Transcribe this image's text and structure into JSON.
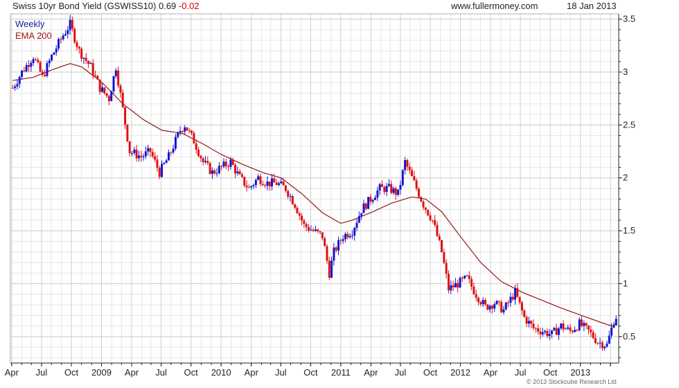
{
  "header": {
    "title": "Swiss 10yr Bond Yield (GSWISS10) 0.69",
    "change": "-0.02",
    "site": "www.fullermoney.com",
    "date": "18 Jan 2013"
  },
  "legend": {
    "weekly": "Weekly",
    "ema": "EMA 200"
  },
  "footer": {
    "copyright": "© 2013 Stockcube Research Ltd"
  },
  "colors": {
    "up_candle": "#1414d2",
    "down_candle": "#e01010",
    "ema_line": "#8b1a1a",
    "grid": "#d8d8d8",
    "axis": "#222222"
  },
  "chart_data": {
    "type": "candlestick",
    "xlabel": "",
    "ylabel": "",
    "ylim": [
      0.25,
      3.55
    ],
    "y_ticks": [
      "0.5",
      "1",
      "1.5",
      "2",
      "2.5",
      "3",
      "3.5"
    ],
    "x_ticks": [
      "Apr",
      "Jul",
      "Oct",
      "2009",
      "Apr",
      "Jul",
      "Oct",
      "2010",
      "Apr",
      "Jul",
      "Oct",
      "2011",
      "Apr",
      "Jul",
      "Oct",
      "2012",
      "Apr",
      "Jul",
      "Oct",
      "2013"
    ],
    "grid": true,
    "series": [
      {
        "name": "Weekly",
        "close_path": [
          [
            "2008-01-04",
            2.85
          ],
          [
            "2008-02-01",
            3.0
          ],
          [
            "2008-03-07",
            3.15
          ],
          [
            "2008-04-04",
            2.95
          ],
          [
            "2008-05-02",
            3.15
          ],
          [
            "2008-06-06",
            3.35
          ],
          [
            "2008-06-27",
            3.45
          ],
          [
            "2008-07-25",
            3.2
          ],
          [
            "2008-08-29",
            3.05
          ],
          [
            "2008-09-26",
            2.85
          ],
          [
            "2008-10-24",
            2.75
          ],
          [
            "2008-11-14",
            3.05
          ],
          [
            "2008-12-05",
            2.65
          ],
          [
            "2008-12-26",
            2.25
          ],
          [
            "2009-01-30",
            2.2
          ],
          [
            "2009-02-27",
            2.25
          ],
          [
            "2009-03-27",
            2.05
          ],
          [
            "2009-04-24",
            2.2
          ],
          [
            "2009-05-29",
            2.45
          ],
          [
            "2009-06-12",
            2.5
          ],
          [
            "2009-07-10",
            2.35
          ],
          [
            "2009-08-07",
            2.15
          ],
          [
            "2009-09-04",
            2.05
          ],
          [
            "2009-10-02",
            2.1
          ],
          [
            "2009-10-30",
            2.15
          ],
          [
            "2009-11-27",
            2.0
          ],
          [
            "2009-12-25",
            1.9
          ],
          [
            "2010-01-22",
            2.0
          ],
          [
            "2010-02-19",
            1.95
          ],
          [
            "2010-03-19",
            1.95
          ],
          [
            "2010-04-16",
            1.9
          ],
          [
            "2010-05-14",
            1.75
          ],
          [
            "2010-06-11",
            1.55
          ],
          [
            "2010-07-09",
            1.5
          ],
          [
            "2010-08-06",
            1.45
          ],
          [
            "2010-08-27",
            1.1
          ],
          [
            "2010-09-10",
            1.3
          ],
          [
            "2010-10-08",
            1.45
          ],
          [
            "2010-11-05",
            1.5
          ],
          [
            "2010-12-03",
            1.7
          ],
          [
            "2010-12-31",
            1.8
          ],
          [
            "2011-01-28",
            1.9
          ],
          [
            "2011-02-25",
            1.9
          ],
          [
            "2011-03-25",
            1.85
          ],
          [
            "2011-04-15",
            2.15
          ],
          [
            "2011-05-13",
            1.95
          ],
          [
            "2011-06-10",
            1.75
          ],
          [
            "2011-07-08",
            1.6
          ],
          [
            "2011-08-05",
            1.3
          ],
          [
            "2011-08-26",
            0.95
          ],
          [
            "2011-09-23",
            1.0
          ],
          [
            "2011-10-21",
            1.05
          ],
          [
            "2011-11-18",
            0.9
          ],
          [
            "2011-12-16",
            0.78
          ],
          [
            "2012-01-13",
            0.82
          ],
          [
            "2012-02-10",
            0.75
          ],
          [
            "2012-03-16",
            0.92
          ],
          [
            "2012-04-13",
            0.68
          ],
          [
            "2012-05-11",
            0.58
          ],
          [
            "2012-06-08",
            0.55
          ],
          [
            "2012-07-06",
            0.52
          ],
          [
            "2012-08-03",
            0.6
          ],
          [
            "2012-08-31",
            0.55
          ],
          [
            "2012-09-28",
            0.62
          ],
          [
            "2012-10-26",
            0.55
          ],
          [
            "2012-11-23",
            0.45
          ],
          [
            "2012-12-21",
            0.42
          ],
          [
            "2013-01-11",
            0.65
          ],
          [
            "2013-01-18",
            0.69
          ]
        ]
      },
      {
        "name": "EMA 200",
        "points": [
          [
            "2008-01-04",
            2.92
          ],
          [
            "2008-03-07",
            2.95
          ],
          [
            "2008-05-02",
            3.02
          ],
          [
            "2008-06-27",
            3.08
          ],
          [
            "2008-08-01",
            3.05
          ],
          [
            "2008-10-03",
            2.9
          ],
          [
            "2008-12-05",
            2.7
          ],
          [
            "2009-02-06",
            2.55
          ],
          [
            "2009-04-03",
            2.45
          ],
          [
            "2009-06-05",
            2.42
          ],
          [
            "2009-08-07",
            2.32
          ],
          [
            "2009-10-02",
            2.22
          ],
          [
            "2009-12-04",
            2.13
          ],
          [
            "2010-02-05",
            2.05
          ],
          [
            "2010-04-02",
            2.0
          ],
          [
            "2010-06-04",
            1.85
          ],
          [
            "2010-08-06",
            1.67
          ],
          [
            "2010-10-01",
            1.57
          ],
          [
            "2010-11-05",
            1.6
          ],
          [
            "2011-01-07",
            1.68
          ],
          [
            "2011-03-04",
            1.76
          ],
          [
            "2011-05-06",
            1.82
          ],
          [
            "2011-06-17",
            1.8
          ],
          [
            "2011-08-05",
            1.68
          ],
          [
            "2011-09-30",
            1.45
          ],
          [
            "2011-12-02",
            1.2
          ],
          [
            "2012-02-03",
            1.02
          ],
          [
            "2012-04-06",
            0.92
          ],
          [
            "2012-06-01",
            0.85
          ],
          [
            "2012-08-03",
            0.77
          ],
          [
            "2012-10-05",
            0.7
          ],
          [
            "2012-12-07",
            0.63
          ],
          [
            "2013-01-04",
            0.6
          ],
          [
            "2013-01-18",
            0.62
          ]
        ]
      }
    ]
  }
}
